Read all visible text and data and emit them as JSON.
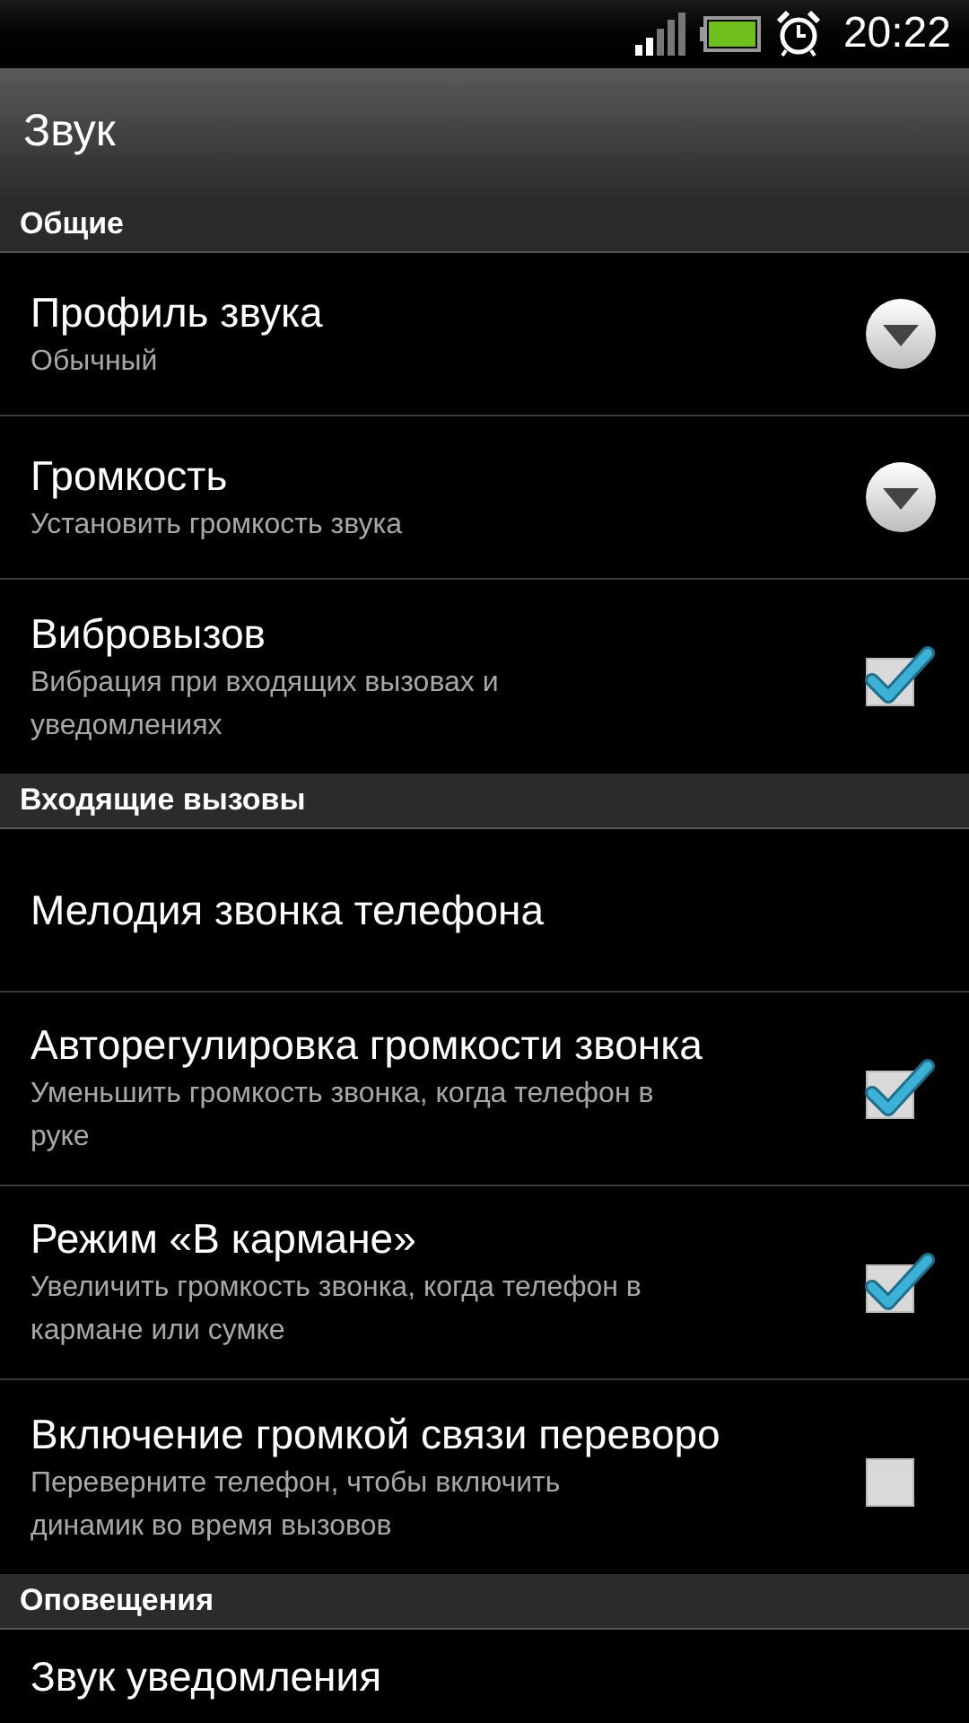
{
  "status_bar": {
    "time": "20:22"
  },
  "title": "Звук",
  "sections": [
    {
      "header": "Общие",
      "items": [
        {
          "kind": "dropdown",
          "title": "Профиль звука",
          "summary": "Обычный"
        },
        {
          "kind": "dropdown",
          "title": "Громкость",
          "summary": "Установить громкость звука"
        },
        {
          "kind": "checkbox",
          "title": "Вибровызов",
          "summary": "Вибрация при входящих вызовах и уведомлениях",
          "checked": true
        }
      ]
    },
    {
      "header": "Входящие вызовы",
      "items": [
        {
          "kind": "plain",
          "title": "Мелодия звонка телефона"
        },
        {
          "kind": "checkbox",
          "title": "Авторегулировка громкости звонка",
          "summary": "Уменьшить громкость звонка, когда телефон в руке",
          "checked": true
        },
        {
          "kind": "checkbox",
          "title": "Режим «В кармане»",
          "summary": "Увеличить громкость звонка, когда телефон в кармане или сумке",
          "checked": true
        },
        {
          "kind": "checkbox",
          "title": "Включение громкой связи переворо",
          "summary": "Переверните телефон, чтобы включить динамик во время вызовов",
          "checked": false
        }
      ]
    },
    {
      "header": "Оповещения",
      "items": [
        {
          "kind": "plain",
          "title": "Звук уведомления"
        }
      ]
    }
  ]
}
